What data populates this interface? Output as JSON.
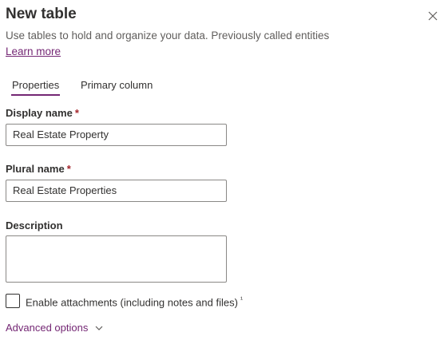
{
  "panel": {
    "title": "New table",
    "subtitle": "Use tables to hold and organize your data. Previously called entities",
    "learn_more": "Learn more"
  },
  "tabs": [
    {
      "label": "Properties",
      "active": true
    },
    {
      "label": "Primary column",
      "active": false
    }
  ],
  "fields": {
    "display_name": {
      "label": "Display name",
      "required": "*",
      "value": "Real Estate Property"
    },
    "plural_name": {
      "label": "Plural name",
      "required": "*",
      "value": "Real Estate Properties"
    },
    "description": {
      "label": "Description",
      "value": ""
    }
  },
  "attachments": {
    "label": "Enable attachments (including notes and files)",
    "footnote": "¹",
    "checked": false
  },
  "advanced": {
    "label": "Advanced options"
  },
  "icons": {
    "close": "close-icon",
    "chevron": "chevron-down-icon"
  },
  "colors": {
    "accent": "#742774",
    "required": "#a4262c",
    "border": "#8a8886"
  }
}
